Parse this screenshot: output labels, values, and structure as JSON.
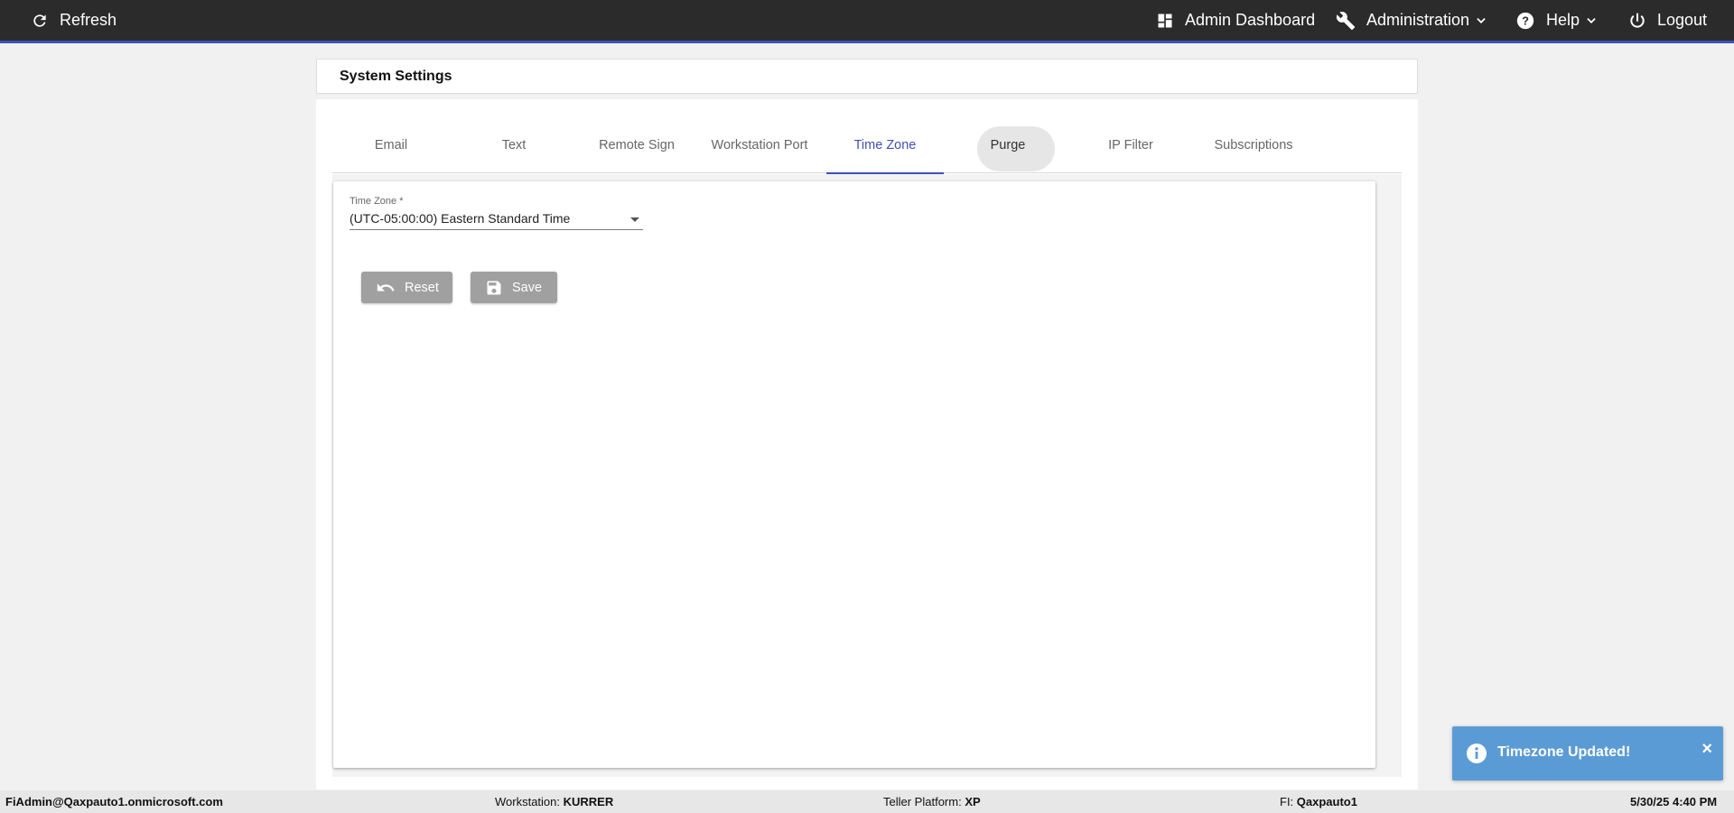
{
  "topbar": {
    "refresh_label": "Refresh",
    "admin_dashboard_label": "Admin Dashboard",
    "administration_label": "Administration",
    "help_label": "Help",
    "logout_label": "Logout",
    "accent_color": "#3f51b5"
  },
  "page": {
    "title": "System Settings"
  },
  "tabs": [
    {
      "label": "Email"
    },
    {
      "label": "Text"
    },
    {
      "label": "Remote Sign"
    },
    {
      "label": "Workstation Port"
    },
    {
      "label": "Time Zone"
    },
    {
      "label": "Purge"
    },
    {
      "label": "IP Filter"
    },
    {
      "label": "Subscriptions"
    }
  ],
  "active_tab": "Time Zone",
  "timezone": {
    "label": "Time Zone *",
    "selected": "(UTC-05:00:00) Eastern Standard Time"
  },
  "buttons": {
    "reset_label": "Reset",
    "save_label": "Save"
  },
  "toast": {
    "message": "Timezone Updated!",
    "close": "×",
    "color": "#5b9bd5"
  },
  "status": {
    "user": "FiAdmin@Qaxpauto1.onmicrosoft.com",
    "workstation_label": "Workstation: ",
    "workstation_value": "KURRER",
    "teller_label": "Teller Platform: ",
    "teller_value": "XP",
    "fi_label": "FI: ",
    "fi_value": "Qaxpauto1",
    "datetime": "5/30/25 4:40 PM"
  }
}
